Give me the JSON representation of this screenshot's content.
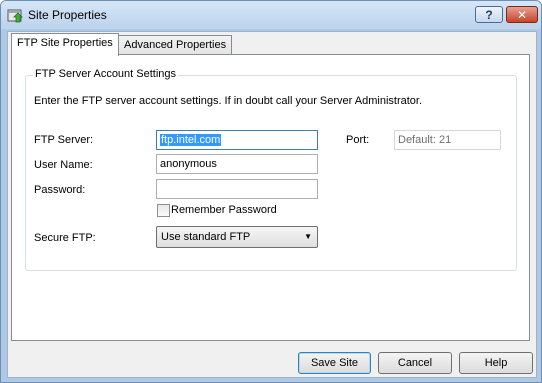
{
  "window": {
    "title": "Site Properties",
    "help_label": "?",
    "close_label": "✕"
  },
  "tabs": [
    {
      "label": "FTP Site Properties",
      "active": true
    },
    {
      "label": "Advanced Properties",
      "active": false
    }
  ],
  "group": {
    "legend": "FTP Server Account Settings",
    "instructions": "Enter the FTP server account settings. If in doubt call your Server Administrator."
  },
  "form": {
    "server_label": "FTP Server:",
    "server_value": "ftp.intel.com",
    "port_label": "Port:",
    "port_placeholder": "Default: 21",
    "username_label": "User Name:",
    "username_value": "anonymous",
    "password_label": "Password:",
    "password_value": "",
    "remember_label": "Remember Password",
    "remember_checked": false,
    "secure_label": "Secure FTP:",
    "secure_value": "Use standard FTP"
  },
  "buttons": {
    "save": "Save Site",
    "cancel": "Cancel",
    "help": "Help"
  }
}
